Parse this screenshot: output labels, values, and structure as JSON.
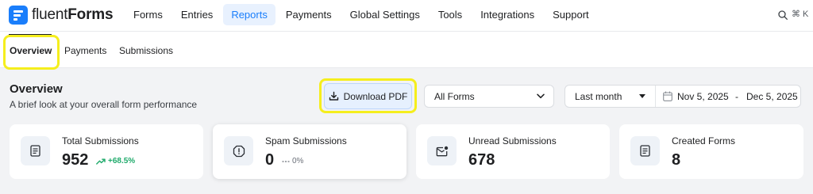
{
  "app": {
    "logo_light": "fluent",
    "logo_bold": "Forms"
  },
  "nav": {
    "items": [
      "Forms",
      "Entries",
      "Reports",
      "Payments",
      "Global Settings",
      "Tools",
      "Integrations",
      "Support"
    ],
    "active": "Reports",
    "search_shortcut": "⌘ K"
  },
  "subnav": {
    "tabs": [
      "Overview",
      "Payments",
      "Submissions"
    ],
    "active": "Overview"
  },
  "header": {
    "title": "Overview",
    "subtitle": "A brief look at your overall form performance",
    "download_label": "Download PDF",
    "forms_select": "All Forms",
    "range_select": "Last month",
    "date_start": "Nov 5, 2025",
    "date_separator": "-",
    "date_end": "Dec 5, 2025"
  },
  "cards": [
    {
      "label": "Total Submissions",
      "value": "952",
      "trend": "+68.5%",
      "icon": "document-icon"
    },
    {
      "label": "Spam Submissions",
      "value": "0",
      "trend": "0%",
      "icon": "spam-alert-icon"
    },
    {
      "label": "Unread Submissions",
      "value": "678",
      "icon": "unread-mail-icon"
    },
    {
      "label": "Created Forms",
      "value": "8",
      "icon": "form-icon"
    }
  ],
  "colors": {
    "accent": "#1a7efb",
    "highlight": "#f5ee1d",
    "positive": "#1faa6b"
  }
}
